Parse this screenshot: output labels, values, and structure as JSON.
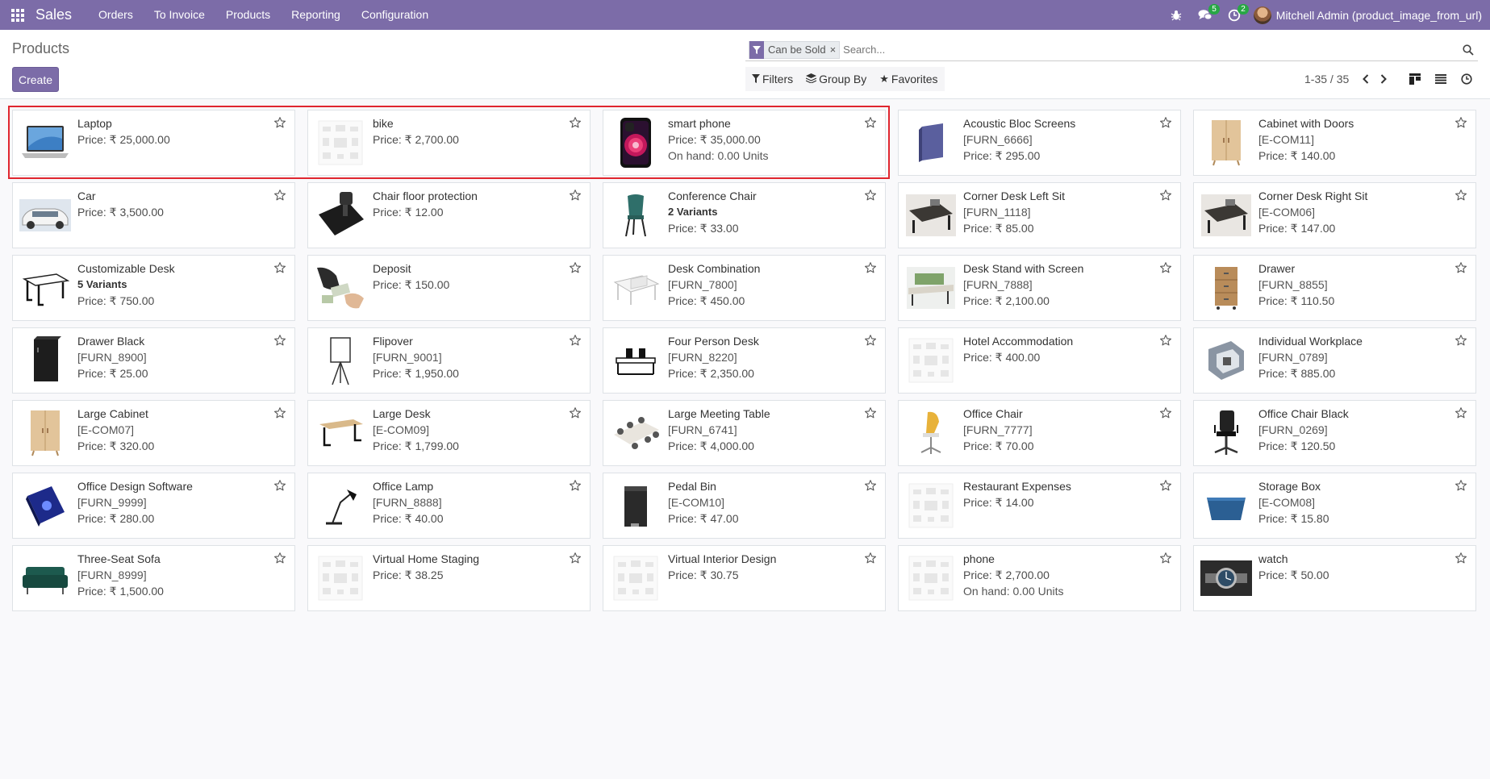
{
  "navbar": {
    "app_name": "Sales",
    "menu": [
      "Orders",
      "To Invoice",
      "Products",
      "Reporting",
      "Configuration"
    ],
    "messages_count": "5",
    "activities_count": "2",
    "user_name": "Mitchell Admin (product_image_from_url)"
  },
  "control_panel": {
    "breadcrumb": "Products",
    "create_label": "Create",
    "facet_label": "Can be Sold",
    "facet_remove": "×",
    "search_placeholder": "Search...",
    "filters_label": "Filters",
    "group_by_label": "Group By",
    "favorites_label": "Favorites",
    "pager_value": "1-35 / 35"
  },
  "colors": {
    "brand": "#7c6ca8",
    "badge": "#28a745",
    "highlight": "#e0262f"
  },
  "products": [
    {
      "name": "Laptop",
      "price": "Price: ₹ 25,000.00",
      "thumb": "laptop"
    },
    {
      "name": "bike",
      "price": "Price: ₹ 2,700.00",
      "thumb": "placeholder"
    },
    {
      "name": "smart phone",
      "price": "Price: ₹ 35,000.00",
      "onhand": "On hand: 0.00 Units",
      "thumb": "phone"
    },
    {
      "name": "Acoustic Bloc Screens",
      "code": "[FURN_6666]",
      "price": "Price: ₹ 295.00",
      "thumb": "screen"
    },
    {
      "name": "Cabinet with Doors",
      "code": "[E-COM11]",
      "price": "Price: ₹ 140.00",
      "thumb": "cabinet"
    },
    {
      "name": "Car",
      "price": "Price: ₹ 3,500.00",
      "thumb": "car"
    },
    {
      "name": "Chair floor protection",
      "price": "Price: ₹ 12.00",
      "thumb": "mat"
    },
    {
      "name": "Conference Chair",
      "variants": "2 Variants",
      "price": "Price: ₹ 33.00",
      "thumb": "chair"
    },
    {
      "name": "Corner Desk Left Sit",
      "code": "[FURN_1118]",
      "price": "Price: ₹ 85.00",
      "thumb": "desk-photo"
    },
    {
      "name": "Corner Desk Right Sit",
      "code": "[E-COM06]",
      "price": "Price: ₹ 147.00",
      "thumb": "desk-photo"
    },
    {
      "name": "Customizable Desk",
      "variants": "5 Variants",
      "price": "Price: ₹ 750.00",
      "thumb": "desk"
    },
    {
      "name": "Deposit",
      "price": "Price: ₹ 150.00",
      "thumb": "money"
    },
    {
      "name": "Desk Combination",
      "code": "[FURN_7800]",
      "price": "Price: ₹ 450.00",
      "thumb": "desk-light"
    },
    {
      "name": "Desk Stand with Screen",
      "code": "[FURN_7888]",
      "price": "Price: ₹ 2,100.00",
      "thumb": "desk-green"
    },
    {
      "name": "Drawer",
      "code": "[FURN_8855]",
      "price": "Price: ₹ 110.50",
      "thumb": "drawer"
    },
    {
      "name": "Drawer Black",
      "code": "[FURN_8900]",
      "price": "Price: ₹ 25.00",
      "thumb": "drawer-black"
    },
    {
      "name": "Flipover",
      "code": "[FURN_9001]",
      "price": "Price: ₹ 1,950.00",
      "thumb": "flipover"
    },
    {
      "name": "Four Person Desk",
      "code": "[FURN_8220]",
      "price": "Price: ₹ 2,350.00",
      "thumb": "desk-four"
    },
    {
      "name": "Hotel Accommodation",
      "price": "Price: ₹ 400.00",
      "thumb": "placeholder"
    },
    {
      "name": "Individual Workplace",
      "code": "[FURN_0789]",
      "price": "Price: ₹ 885.00",
      "thumb": "workplace"
    },
    {
      "name": "Large Cabinet",
      "code": "[E-COM07]",
      "price": "Price: ₹ 320.00",
      "thumb": "cabinet"
    },
    {
      "name": "Large Desk",
      "code": "[E-COM09]",
      "price": "Price: ₹ 1,799.00",
      "thumb": "desk-large"
    },
    {
      "name": "Large Meeting Table",
      "code": "[FURN_6741]",
      "price": "Price: ₹ 4,000.00",
      "thumb": "meeting"
    },
    {
      "name": "Office Chair",
      "code": "[FURN_7777]",
      "price": "Price: ₹ 70.00",
      "thumb": "chair-yellow"
    },
    {
      "name": "Office Chair Black",
      "code": "[FURN_0269]",
      "price": "Price: ₹ 120.50",
      "thumb": "chair-black"
    },
    {
      "name": "Office Design Software",
      "code": "[FURN_9999]",
      "price": "Price: ₹ 280.00",
      "thumb": "software"
    },
    {
      "name": "Office Lamp",
      "code": "[FURN_8888]",
      "price": "Price: ₹ 40.00",
      "thumb": "lamp"
    },
    {
      "name": "Pedal Bin",
      "code": "[E-COM10]",
      "price": "Price: ₹ 47.00",
      "thumb": "bin"
    },
    {
      "name": "Restaurant Expenses",
      "price": "Price: ₹ 14.00",
      "thumb": "placeholder"
    },
    {
      "name": "Storage Box",
      "code": "[E-COM08]",
      "price": "Price: ₹ 15.80",
      "thumb": "box"
    },
    {
      "name": "Three-Seat Sofa",
      "code": "[FURN_8999]",
      "price": "Price: ₹ 1,500.00",
      "thumb": "sofa"
    },
    {
      "name": "Virtual Home Staging",
      "price": "Price: ₹ 38.25",
      "thumb": "placeholder"
    },
    {
      "name": "Virtual Interior Design",
      "price": "Price: ₹ 30.75",
      "thumb": "placeholder"
    },
    {
      "name": "phone",
      "price": "Price: ₹ 2,700.00",
      "onhand": "On hand: 0.00 Units",
      "thumb": "placeholder"
    },
    {
      "name": "watch",
      "price": "Price: ₹ 50.00",
      "thumb": "watch"
    }
  ]
}
